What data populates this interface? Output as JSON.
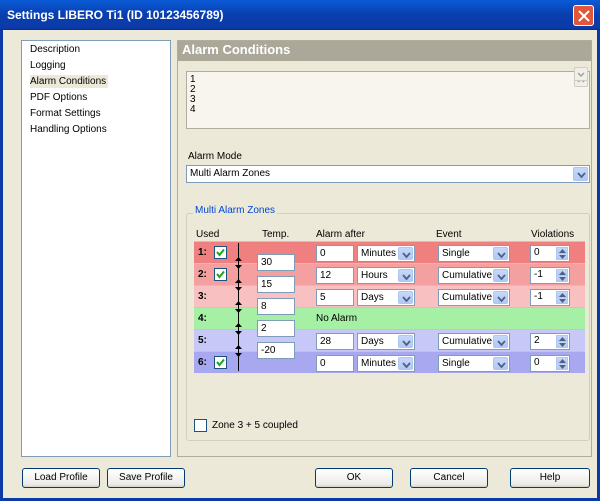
{
  "window": {
    "title": "Settings LIBERO Ti1 (ID 10123456789)"
  },
  "nav": {
    "items": [
      {
        "label": "Description"
      },
      {
        "label": "Logging"
      },
      {
        "label": "Alarm Conditions"
      },
      {
        "label": "PDF Options"
      },
      {
        "label": "Format Settings"
      },
      {
        "label": "Handling Options"
      }
    ]
  },
  "panel": {
    "title": "Alarm Conditions",
    "text_lines": [
      "1",
      "2",
      "3",
      "4"
    ],
    "alarm_mode_label": "Alarm Mode",
    "alarm_mode_value": "Multi Alarm Zones",
    "group_title": "Multi Alarm Zones",
    "columns": [
      "Used",
      "Temp.",
      "Alarm after",
      "Event",
      "Violations"
    ],
    "zones": [
      {
        "num": "1:",
        "checked": true,
        "amount": "0",
        "unit": "Minutes",
        "event": "Single",
        "violations": "0",
        "color": "#f08080"
      },
      {
        "num": "2:",
        "checked": true,
        "amount": "12",
        "unit": "Hours",
        "event": "Cumulative",
        "violations": "-1",
        "color": "#f5a0a0"
      },
      {
        "num": "3:",
        "checked": false,
        "amount": "5",
        "unit": "Days",
        "event": "Cumulative",
        "violations": "-1",
        "color": "#f8c0c0"
      },
      {
        "num": "4:",
        "no_alarm": "No Alarm",
        "color": "#a6f0a6"
      },
      {
        "num": "5:",
        "checked": false,
        "amount": "28",
        "unit": "Days",
        "event": "Cumulative",
        "violations": "2",
        "color": "#c8c8f8"
      },
      {
        "num": "6:",
        "checked": true,
        "amount": "0",
        "unit": "Minutes",
        "event": "Single",
        "violations": "0",
        "color": "#a8a8f0"
      }
    ],
    "temps": [
      "30",
      "15",
      "8",
      "2",
      "-20"
    ],
    "coupled_label": "Zone 3 + 5 coupled"
  },
  "buttons": {
    "load_profile": "Load Profile",
    "save_profile": "Save Profile",
    "ok": "OK",
    "cancel": "Cancel",
    "help": "Help"
  }
}
